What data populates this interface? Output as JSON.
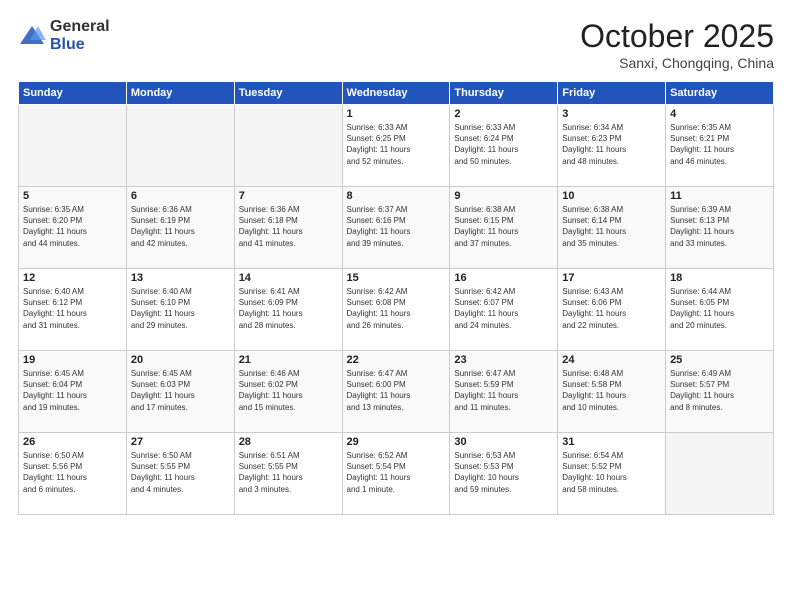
{
  "logo": {
    "general": "General",
    "blue": "Blue"
  },
  "header": {
    "month": "October 2025",
    "location": "Sanxi, Chongqing, China"
  },
  "weekdays": [
    "Sunday",
    "Monday",
    "Tuesday",
    "Wednesday",
    "Thursday",
    "Friday",
    "Saturday"
  ],
  "weeks": [
    [
      {
        "day": "",
        "info": ""
      },
      {
        "day": "",
        "info": ""
      },
      {
        "day": "",
        "info": ""
      },
      {
        "day": "1",
        "info": "Sunrise: 6:33 AM\nSunset: 6:25 PM\nDaylight: 11 hours\nand 52 minutes."
      },
      {
        "day": "2",
        "info": "Sunrise: 6:33 AM\nSunset: 6:24 PM\nDaylight: 11 hours\nand 50 minutes."
      },
      {
        "day": "3",
        "info": "Sunrise: 6:34 AM\nSunset: 6:23 PM\nDaylight: 11 hours\nand 48 minutes."
      },
      {
        "day": "4",
        "info": "Sunrise: 6:35 AM\nSunset: 6:21 PM\nDaylight: 11 hours\nand 46 minutes."
      }
    ],
    [
      {
        "day": "5",
        "info": "Sunrise: 6:35 AM\nSunset: 6:20 PM\nDaylight: 11 hours\nand 44 minutes."
      },
      {
        "day": "6",
        "info": "Sunrise: 6:36 AM\nSunset: 6:19 PM\nDaylight: 11 hours\nand 42 minutes."
      },
      {
        "day": "7",
        "info": "Sunrise: 6:36 AM\nSunset: 6:18 PM\nDaylight: 11 hours\nand 41 minutes."
      },
      {
        "day": "8",
        "info": "Sunrise: 6:37 AM\nSunset: 6:16 PM\nDaylight: 11 hours\nand 39 minutes."
      },
      {
        "day": "9",
        "info": "Sunrise: 6:38 AM\nSunset: 6:15 PM\nDaylight: 11 hours\nand 37 minutes."
      },
      {
        "day": "10",
        "info": "Sunrise: 6:38 AM\nSunset: 6:14 PM\nDaylight: 11 hours\nand 35 minutes."
      },
      {
        "day": "11",
        "info": "Sunrise: 6:39 AM\nSunset: 6:13 PM\nDaylight: 11 hours\nand 33 minutes."
      }
    ],
    [
      {
        "day": "12",
        "info": "Sunrise: 6:40 AM\nSunset: 6:12 PM\nDaylight: 11 hours\nand 31 minutes."
      },
      {
        "day": "13",
        "info": "Sunrise: 6:40 AM\nSunset: 6:10 PM\nDaylight: 11 hours\nand 29 minutes."
      },
      {
        "day": "14",
        "info": "Sunrise: 6:41 AM\nSunset: 6:09 PM\nDaylight: 11 hours\nand 28 minutes."
      },
      {
        "day": "15",
        "info": "Sunrise: 6:42 AM\nSunset: 6:08 PM\nDaylight: 11 hours\nand 26 minutes."
      },
      {
        "day": "16",
        "info": "Sunrise: 6:42 AM\nSunset: 6:07 PM\nDaylight: 11 hours\nand 24 minutes."
      },
      {
        "day": "17",
        "info": "Sunrise: 6:43 AM\nSunset: 6:06 PM\nDaylight: 11 hours\nand 22 minutes."
      },
      {
        "day": "18",
        "info": "Sunrise: 6:44 AM\nSunset: 6:05 PM\nDaylight: 11 hours\nand 20 minutes."
      }
    ],
    [
      {
        "day": "19",
        "info": "Sunrise: 6:45 AM\nSunset: 6:04 PM\nDaylight: 11 hours\nand 19 minutes."
      },
      {
        "day": "20",
        "info": "Sunrise: 6:45 AM\nSunset: 6:03 PM\nDaylight: 11 hours\nand 17 minutes."
      },
      {
        "day": "21",
        "info": "Sunrise: 6:46 AM\nSunset: 6:02 PM\nDaylight: 11 hours\nand 15 minutes."
      },
      {
        "day": "22",
        "info": "Sunrise: 6:47 AM\nSunset: 6:00 PM\nDaylight: 11 hours\nand 13 minutes."
      },
      {
        "day": "23",
        "info": "Sunrise: 6:47 AM\nSunset: 5:59 PM\nDaylight: 11 hours\nand 11 minutes."
      },
      {
        "day": "24",
        "info": "Sunrise: 6:48 AM\nSunset: 5:58 PM\nDaylight: 11 hours\nand 10 minutes."
      },
      {
        "day": "25",
        "info": "Sunrise: 6:49 AM\nSunset: 5:57 PM\nDaylight: 11 hours\nand 8 minutes."
      }
    ],
    [
      {
        "day": "26",
        "info": "Sunrise: 6:50 AM\nSunset: 5:56 PM\nDaylight: 11 hours\nand 6 minutes."
      },
      {
        "day": "27",
        "info": "Sunrise: 6:50 AM\nSunset: 5:55 PM\nDaylight: 11 hours\nand 4 minutes."
      },
      {
        "day": "28",
        "info": "Sunrise: 6:51 AM\nSunset: 5:55 PM\nDaylight: 11 hours\nand 3 minutes."
      },
      {
        "day": "29",
        "info": "Sunrise: 6:52 AM\nSunset: 5:54 PM\nDaylight: 11 hours\nand 1 minute."
      },
      {
        "day": "30",
        "info": "Sunrise: 6:53 AM\nSunset: 5:53 PM\nDaylight: 10 hours\nand 59 minutes."
      },
      {
        "day": "31",
        "info": "Sunrise: 6:54 AM\nSunset: 5:52 PM\nDaylight: 10 hours\nand 58 minutes."
      },
      {
        "day": "",
        "info": ""
      }
    ]
  ]
}
